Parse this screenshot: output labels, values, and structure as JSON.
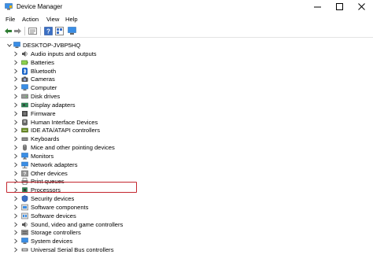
{
  "window": {
    "title": "Device Manager"
  },
  "menu": [
    "File",
    "Action",
    "View",
    "Help"
  ],
  "tree": {
    "root": "DESKTOP-JVBP5HQ",
    "items": [
      {
        "label": "Audio inputs and outputs",
        "icon": "audio-icon"
      },
      {
        "label": "Batteries",
        "icon": "battery-icon"
      },
      {
        "label": "Bluetooth",
        "icon": "bluetooth-icon"
      },
      {
        "label": "Cameras",
        "icon": "camera-icon"
      },
      {
        "label": "Computer",
        "icon": "computer-icon"
      },
      {
        "label": "Disk drives",
        "icon": "disk-drive-icon"
      },
      {
        "label": "Display adapters",
        "icon": "display-adapter-icon"
      },
      {
        "label": "Firmware",
        "icon": "firmware-icon"
      },
      {
        "label": "Human Interface Devices",
        "icon": "hid-icon"
      },
      {
        "label": "IDE ATA/ATAPI controllers",
        "icon": "ide-controller-icon"
      },
      {
        "label": "Keyboards",
        "icon": "keyboard-icon"
      },
      {
        "label": "Mice and other pointing devices",
        "icon": "mouse-icon"
      },
      {
        "label": "Monitors",
        "icon": "monitor-icon"
      },
      {
        "label": "Network adapters",
        "icon": "network-adapter-icon"
      },
      {
        "label": "Other devices",
        "icon": "other-devices-icon"
      },
      {
        "label": "Print queues",
        "icon": "printer-icon"
      },
      {
        "label": "Processors",
        "icon": "processor-icon"
      },
      {
        "label": "Security devices",
        "icon": "security-icon"
      },
      {
        "label": "Software components",
        "icon": "software-component-icon"
      },
      {
        "label": "Software devices",
        "icon": "software-device-icon"
      },
      {
        "label": "Sound, video and game controllers",
        "icon": "sound-icon"
      },
      {
        "label": "Storage controllers",
        "icon": "storage-controller-icon"
      },
      {
        "label": "System devices",
        "icon": "system-devices-icon"
      },
      {
        "label": "Universal Serial Bus controllers",
        "icon": "usb-icon"
      }
    ]
  },
  "highlight": {
    "item": "Sound, video and game controllers",
    "color": "#c4262e"
  },
  "colors": {
    "accent": "#1a64c8",
    "highlight_border": "#c4262e"
  }
}
